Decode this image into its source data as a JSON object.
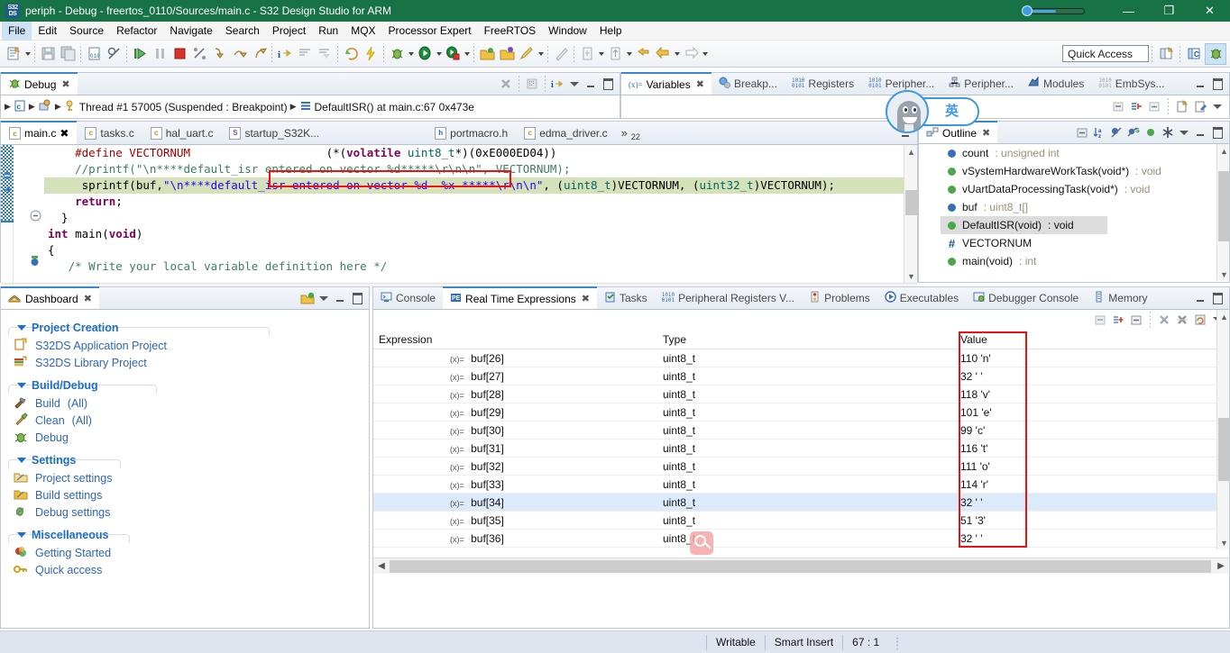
{
  "window": {
    "title": "periph - Debug - freertos_0110/Sources/main.c - S32 Design Studio for ARM",
    "app_icon_line1": "S32",
    "app_icon_line2": "DS",
    "minimize": "—",
    "restore": "❐",
    "close": "✕"
  },
  "menubar": [
    {
      "label": "File"
    },
    {
      "label": "Edit"
    },
    {
      "label": "Source"
    },
    {
      "label": "Refactor"
    },
    {
      "label": "Navigate"
    },
    {
      "label": "Search"
    },
    {
      "label": "Project"
    },
    {
      "label": "Run"
    },
    {
      "label": "MQX"
    },
    {
      "label": "Processor Expert"
    },
    {
      "label": "FreeRTOS"
    },
    {
      "label": "Window"
    },
    {
      "label": "Help"
    }
  ],
  "toolbar": {
    "quick_access_placeholder": "Quick Access",
    "icons": [
      "new-wizard-icon",
      "save-icon",
      "save-all-icon",
      "new-c-file-icon",
      "skip-breakpoints-icon",
      "resume-icon",
      "suspend-icon",
      "terminate-icon",
      "disconnect-icon",
      "step-into-icon",
      "step-over-icon",
      "step-return-icon",
      "instruction-stepping-icon",
      "collapse-frames-icon",
      "drop-to-frame-icon",
      "build-icon",
      "build-all-icon",
      "debug-icon",
      "run-icon",
      "external-tools-icon",
      "open-folder-icon",
      "open-type-icon",
      "marker-icon",
      "ruler-icon",
      "next-annotation-icon",
      "previous-annotation-icon",
      "back-icon",
      "forward-icon"
    ],
    "perspective_new_icon": "new-perspective-icon",
    "perspective_c_icon": "perspective-c-cpp",
    "perspective_debug_icon": "perspective-debug"
  },
  "debug_view": {
    "tab_label": "Debug",
    "close_glyph": "✖",
    "stack": {
      "launch_config_icon": "c-launch-icon",
      "process_icon": "process-icon",
      "thread_icon": "thread-icon",
      "thread_label": "Thread #1 57005 (Suspended : Breakpoint)",
      "frame_icon": "stack-frame-icon",
      "frame_label": "DefaultISR() at main.c:67 0x473e"
    },
    "tools": [
      "remove-all-terminated-icon",
      "view-menu-icon",
      "instruction-stepping-icon"
    ]
  },
  "variables_view": {
    "tabs": [
      {
        "label": "Variables",
        "icon": "variables-icon",
        "active": true,
        "closable": true
      },
      {
        "label": "Breakp...",
        "icon": "breakpoints-icon",
        "active": false
      },
      {
        "label": "Registers",
        "icon": "registers-icon",
        "active": false
      },
      {
        "label": "Peripher...",
        "icon": "peripherals-bits-icon",
        "active": false
      },
      {
        "label": "Peripher...",
        "icon": "peripherals-tree-icon",
        "active": false
      },
      {
        "label": "Modules",
        "icon": "modules-icon",
        "active": false
      },
      {
        "label": "EmbSys...",
        "icon": "embsys-icon",
        "active": false
      }
    ],
    "tools": [
      "collapse-all-icon",
      "add-watch-icon",
      "remove-icon",
      "new-expression-icon",
      "edit-expression-icon",
      "view-menu-icon"
    ]
  },
  "editor": {
    "tabs": [
      {
        "label": "main.c",
        "kind": "c",
        "active": true,
        "closable": true
      },
      {
        "label": "tasks.c",
        "kind": "c",
        "active": false
      },
      {
        "label": "hal_uart.c",
        "kind": "c",
        "active": false
      },
      {
        "label": "startup_S32K...",
        "kind": "s",
        "active": false
      },
      {
        "label": "portmacro.h",
        "kind": "h",
        "active": false
      },
      {
        "label": "edma_driver.c",
        "kind": "c",
        "active": false
      }
    ],
    "more_tabs_glyph": "»",
    "more_tabs_count": "22",
    "code_lines": [
      {
        "id": "l1",
        "text": "    #define VECTORNUM                    (*(volatile uint8_t*)(0xE000ED04))"
      },
      {
        "id": "l2",
        "text": "    //printf(\"\\n****default_isr entered on vector %d*****\\r\\n\\n\", VECTORNUM);"
      },
      {
        "id": "l3",
        "text": "     sprintf(buf,\"\\n****default_isr entered on vector %d  %x *****\\r\\n\\n\", (uint8_t)VECTORNUM, (uint32_t)VECTORNUM);"
      },
      {
        "id": "l4",
        "text": "    return;"
      },
      {
        "id": "l5",
        "text": "  }"
      },
      {
        "id": "l6",
        "text": "int main(void)"
      },
      {
        "id": "l7",
        "text": "{"
      },
      {
        "id": "l8",
        "text": "   /* Write your local variable definition here */"
      }
    ],
    "highlight_annotation": "red-rectangle-highlight"
  },
  "outline": {
    "tab_label": "Outline",
    "close_glyph": "✖",
    "tools": [
      "collapse-all-icon",
      "sort-icon",
      "hide-fields-icon",
      "hide-static-icon",
      "hide-nonpublic-icon",
      "filter-icon",
      "view-menu-icon"
    ],
    "items": [
      {
        "name": "count",
        "sep": " : ",
        "type": "unsigned int",
        "marker": "blue",
        "selected": false
      },
      {
        "name": "vSystemHardwareWorkTask(void*)",
        "sep": " : ",
        "type": "void",
        "marker": "green",
        "selected": false
      },
      {
        "name": "vUartDataProcessingTask(void*)",
        "sep": " : ",
        "type": "void",
        "marker": "green",
        "selected": false
      },
      {
        "name": "buf",
        "sep": " : ",
        "type": "uint8_t[]",
        "marker": "blue",
        "selected": false
      },
      {
        "name": "DefaultISR(void)",
        "sep": " : ",
        "type": "void",
        "marker": "green",
        "selected": true
      },
      {
        "name": "VECTORNUM",
        "sep": "",
        "type": "",
        "marker": "hash",
        "selected": false
      },
      {
        "name": "main(void)",
        "sep": " : ",
        "type": "int",
        "marker": "green",
        "selected": false
      }
    ]
  },
  "dashboard": {
    "tab_label": "Dashboard",
    "close_glyph": "✖",
    "sections": [
      {
        "title": "Project Creation",
        "items": [
          {
            "label": "S32DS Application Project",
            "suffix": "",
            "icon": "new-project-icon"
          },
          {
            "label": "S32DS Library Project",
            "suffix": "",
            "icon": "new-library-icon"
          }
        ]
      },
      {
        "title": "Build/Debug",
        "items": [
          {
            "label": "Build",
            "suffix": "(All)",
            "icon": "hammer-icon"
          },
          {
            "label": "Clean",
            "suffix": "(All)",
            "icon": "broom-icon"
          },
          {
            "label": "Debug",
            "suffix": "",
            "icon": "bug-icon"
          }
        ]
      },
      {
        "title": "Settings",
        "items": [
          {
            "label": "Project settings",
            "suffix": "",
            "icon": "project-settings-icon"
          },
          {
            "label": "Build settings",
            "suffix": "",
            "icon": "build-settings-icon"
          },
          {
            "label": "Debug settings",
            "suffix": "",
            "icon": "debug-settings-icon"
          }
        ]
      },
      {
        "title": "Miscellaneous",
        "items": [
          {
            "label": "Getting Started",
            "suffix": "",
            "icon": "getting-started-icon"
          },
          {
            "label": "Quick access",
            "suffix": "",
            "icon": "key-icon"
          }
        ]
      }
    ]
  },
  "rte": {
    "tabs": [
      {
        "label": "Console",
        "icon": "console-icon",
        "active": false
      },
      {
        "label": "Real Time Expressions",
        "icon": "rte-icon",
        "active": true,
        "closable": true
      },
      {
        "label": "Tasks",
        "icon": "tasks-icon",
        "active": false
      },
      {
        "label": "Peripheral Registers V...",
        "icon": "peripheral-registers-icon",
        "active": false
      },
      {
        "label": "Problems",
        "icon": "problems-icon",
        "active": false
      },
      {
        "label": "Executables",
        "icon": "executables-icon",
        "active": false
      },
      {
        "label": "Debugger Console",
        "icon": "debugger-console-icon",
        "active": false
      },
      {
        "label": "Memory",
        "icon": "memory-icon",
        "active": false
      }
    ],
    "columns": [
      "Expression",
      "Type",
      "Value"
    ],
    "rows": [
      {
        "expression": "buf[26]",
        "type": "uint8_t",
        "value": "110 'n'",
        "selected": false
      },
      {
        "expression": "buf[27]",
        "type": "uint8_t",
        "value": "32 ' '",
        "selected": false
      },
      {
        "expression": "buf[28]",
        "type": "uint8_t",
        "value": "118 'v'",
        "selected": false
      },
      {
        "expression": "buf[29]",
        "type": "uint8_t",
        "value": "101 'e'",
        "selected": false
      },
      {
        "expression": "buf[30]",
        "type": "uint8_t",
        "value": "99 'c'",
        "selected": false
      },
      {
        "expression": "buf[31]",
        "type": "uint8_t",
        "value": "116 't'",
        "selected": false
      },
      {
        "expression": "buf[32]",
        "type": "uint8_t",
        "value": "111 'o'",
        "selected": false
      },
      {
        "expression": "buf[33]",
        "type": "uint8_t",
        "value": "114 'r'",
        "selected": false
      },
      {
        "expression": "buf[34]",
        "type": "uint8_t",
        "value": "32 ' '",
        "selected": true
      },
      {
        "expression": "buf[35]",
        "type": "uint8_t",
        "value": "51 '3'",
        "selected": false
      },
      {
        "expression": "buf[36]",
        "type": "uint8_t",
        "value": "32 ' '",
        "selected": false
      }
    ],
    "tools": [
      "collapse-all-icon",
      "add-expression-icon",
      "remove-icon",
      "remove-all-icon",
      "remove-selected-icon",
      "refresh-icon",
      "view-menu-icon"
    ]
  },
  "statusbar": {
    "writable": "Writable",
    "insert_mode": "Smart Insert",
    "caret_position": "67 : 1"
  },
  "ime": {
    "mode_label": "英",
    "widget_name": "sogou-ime-floating-bar"
  },
  "colors": {
    "title_green": "#177245",
    "accent_blue": "#3b87c9",
    "annotation_red": "#ee1111",
    "highlight_line": "#d5e1b8",
    "selection_blue": "#dcebf9"
  }
}
